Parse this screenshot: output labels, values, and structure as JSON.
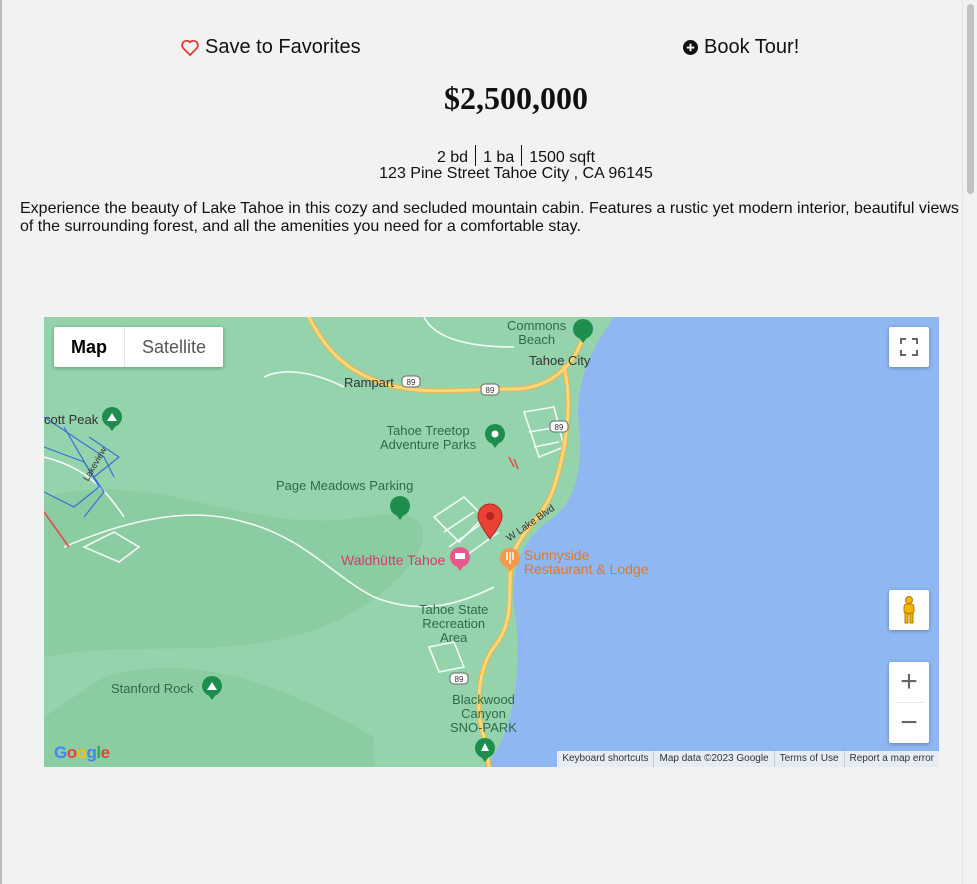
{
  "actions": {
    "favorites": "Save to Favorites",
    "book_tour": "Book Tour!"
  },
  "listing": {
    "price": "$2,500,000",
    "beds": "2 bd",
    "baths": "1 ba",
    "sqft": "1500 sqft",
    "address": "123 Pine Street Tahoe City , CA 96145",
    "description": "Experience the beauty of Lake Tahoe in this cozy and secluded mountain cabin. Features a rustic yet modern interior, beautiful views of the surrounding forest, and all the amenities you need for a comfortable stay."
  },
  "map": {
    "type_buttons": {
      "map": "Map",
      "satellite": "Satellite"
    },
    "labels": {
      "commons_beach": "Commons\nBeach",
      "tahoe_city": "Tahoe City",
      "rampart": "Rampart",
      "scott_peak": "cott Peak",
      "treetop": "Tahoe Treetop\nAdventure Parks",
      "page_meadows": "Page Meadows Parking",
      "waldhutte": "Waldhütte Tahoe",
      "sunnyside": "Sunnyside\nRestaurant & Lodge",
      "w_lake_blvd": "W Lake Blvd",
      "lakeview": "Lakeview",
      "state_rec": "Tahoe State\nRecreation\nArea",
      "stanford_rock": "Stanford Rock",
      "blackwood": "Blackwood\nCanyon\nSNO-PARK",
      "route_89": "89"
    },
    "attribution": {
      "shortcuts": "Keyboard shortcuts",
      "map_data": "Map data ©2023 Google",
      "terms": "Terms of Use",
      "report": "Report a map error"
    },
    "logo": "Google",
    "zoom_in": "+",
    "zoom_out": "−"
  },
  "colors": {
    "land": "#94d3ac",
    "water": "#8fb8f2",
    "road": "#f6c45c",
    "marker": "#e53935",
    "heart": "#e53935"
  }
}
